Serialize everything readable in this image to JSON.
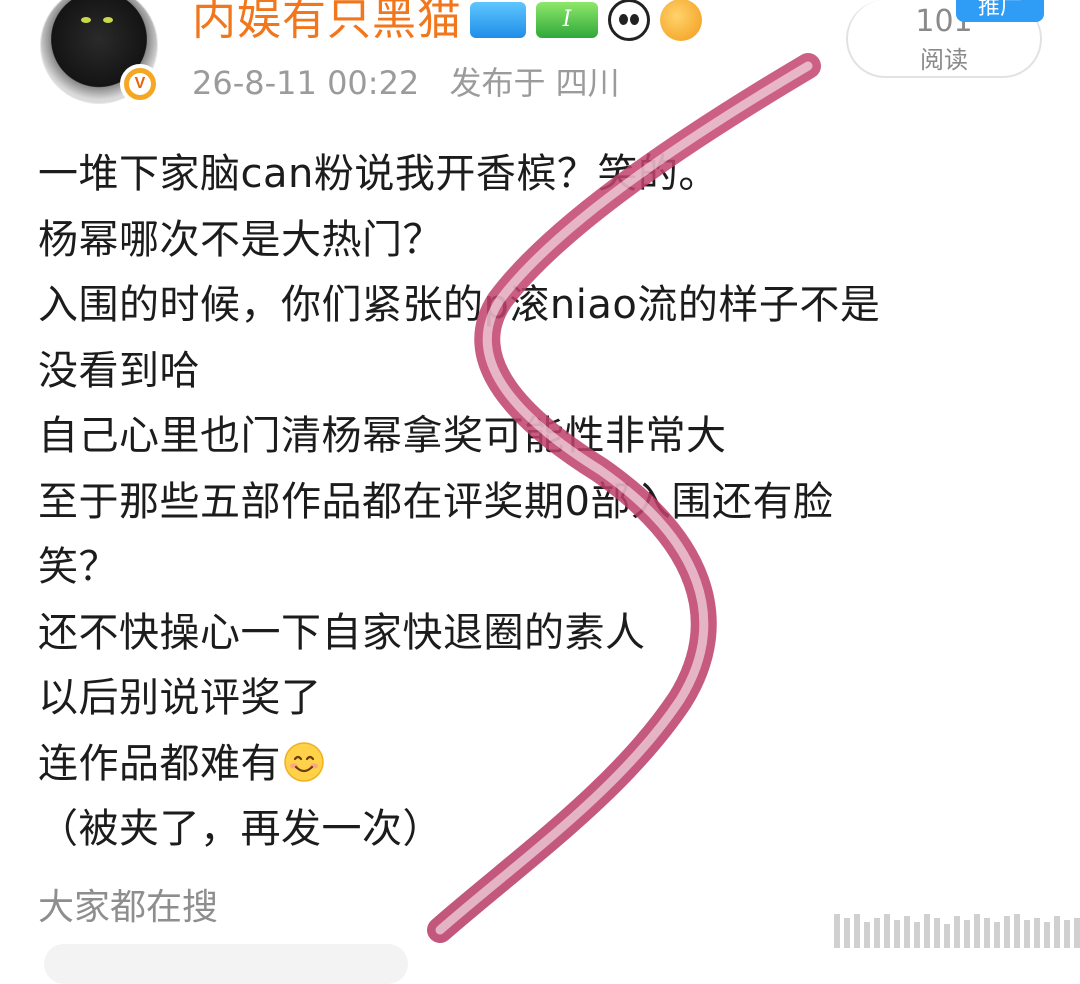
{
  "author": {
    "name": "内娱有只黑猫",
    "verified_badge": "V",
    "badges": [
      "ship-badge-icon",
      "level-badge-icon",
      "panda-icon",
      "fish-icon"
    ],
    "level_badge_text": "I"
  },
  "meta": {
    "timestamp": "26-8-11 00:22",
    "location": "发布于 四川"
  },
  "stats": {
    "read_count": "101",
    "read_label": "阅读",
    "promo_tag": "推广"
  },
  "post": {
    "lines": [
      "一堆下家脑can粉说我开香槟？笑的。",
      "杨幂哪次不是大热门？",
      "入围的时候，你们紧张的p滚niao流的样子不是",
      "没看到哈",
      "自己心里也门清杨幂拿奖可能性非常大",
      "至于那些五部作品都在评奖期0部入围还有脸",
      "笑？",
      "还不快操心一下自家快退圈的素人",
      "以后别说评奖了",
      "连作品都难有",
      "（被夹了，再发一次）"
    ],
    "emoji_after_line": "smile-emoji-icon"
  },
  "search": {
    "title": "大家都在搜"
  },
  "colors": {
    "username": "#f2761c",
    "meta_text": "#9b9b9b",
    "promo": "#2f9cf5",
    "overlay_stroke": "#c4456f"
  }
}
